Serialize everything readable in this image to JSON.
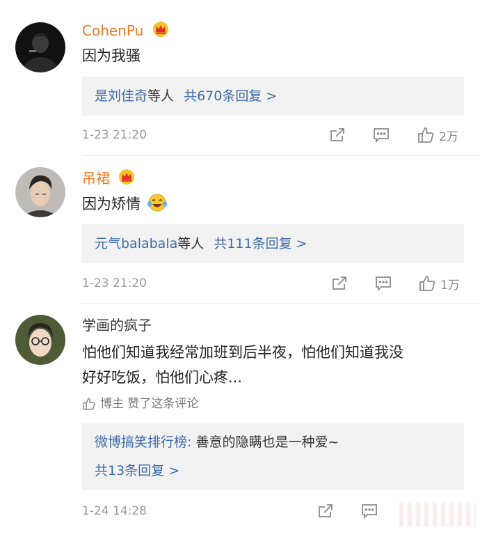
{
  "comments": [
    {
      "user": "CohenPu",
      "text": "因为我骚",
      "reply_summary": {
        "names": "是刘佳奇",
        "mid": "等人",
        "count": "共670条回复 >"
      },
      "time": "1-23 21:20",
      "likes": "2万",
      "avatar": "dark-portrait-avatar",
      "badge": "crown-vip-icon"
    },
    {
      "user": "吊裙",
      "text": "因为矫情",
      "emoji": "laughing-crying-emoji",
      "reply_summary": {
        "names": "元气balabala",
        "mid": "等人",
        "count": "共111条回复 >"
      },
      "time": "1-23 21:20",
      "likes": "1万",
      "avatar": "young-man-avatar",
      "badge": "crown-vip-icon"
    },
    {
      "user": "学画的疯子",
      "text_line1": "怕他们知道我经常加班到后半夜，怕他们知道我没",
      "text_line2": "好好吃饭，怕他们心疼...",
      "liked_by_author": "博主 赞了这条评论",
      "reply_preview": {
        "author": "微博搞笑排行榜",
        "sep": ": ",
        "text": "善意的隐瞒也是一种爱~"
      },
      "reply_count": "共13条回复 >",
      "time": "1-24 14:28",
      "avatar": "woman-glasses-avatar"
    }
  ],
  "colors": {
    "vip_name": "#f0781e",
    "link": "#3f6aa8",
    "reply_bg": "#f2f2f2",
    "meta": "#9a9a9a"
  }
}
